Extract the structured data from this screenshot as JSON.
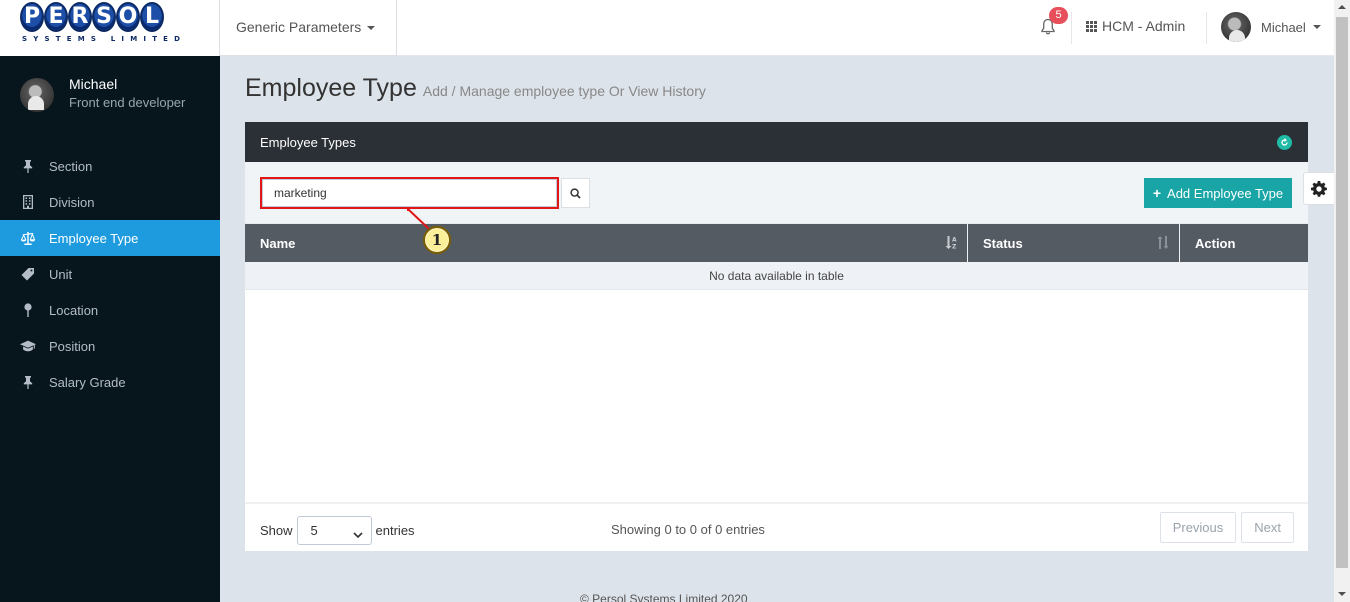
{
  "header": {
    "logo_text": "PERSOL",
    "logo_sub": "SYSTEMS LIMITED",
    "module_dropdown": "Generic Parameters",
    "notification_count": "5",
    "app_switcher": "HCM - Admin",
    "user_name": "Michael"
  },
  "sidebar": {
    "profile": {
      "name": "Michael",
      "role": "Front end developer"
    },
    "items": [
      {
        "label": "Section",
        "icon": "pin-icon",
        "active": false
      },
      {
        "label": "Division",
        "icon": "building-icon",
        "active": false
      },
      {
        "label": "Employee Type",
        "icon": "balance-scale-icon",
        "active": true
      },
      {
        "label": "Unit",
        "icon": "tag-icon",
        "active": false
      },
      {
        "label": "Location",
        "icon": "map-pin-icon",
        "active": false
      },
      {
        "label": "Position",
        "icon": "graduation-cap-icon",
        "active": false
      },
      {
        "label": "Salary Grade",
        "icon": "pin-icon",
        "active": false
      }
    ]
  },
  "page": {
    "title": "Employee Type",
    "subtitle": "Add / Manage employee type Or View History"
  },
  "portlet": {
    "title": "Employee Types",
    "search": {
      "value": "marketing"
    },
    "add_button": "Add Employee Type",
    "callout": "1",
    "table": {
      "columns": [
        "Name",
        "Status",
        "Action"
      ],
      "empty_message": "No data available in table"
    },
    "footer": {
      "show_label": "Show",
      "page_size": "5",
      "entries_label": "entries",
      "info": "Showing 0 to 0 of 0 entries",
      "prev": "Previous",
      "next": "Next"
    }
  },
  "copyright": "© Persol Systems Limited 2020",
  "colors": {
    "sidebar_bg": "#07161d",
    "active_item": "#1d9bde",
    "add_button": "#19a4a6",
    "highlight_border": "#e11616",
    "badge": "#e7505a"
  }
}
